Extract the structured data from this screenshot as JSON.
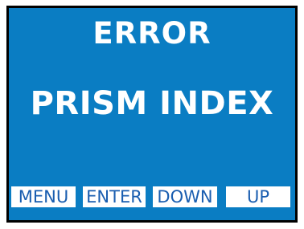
{
  "display": {
    "title": "ERROR",
    "message": "PRISM INDEX",
    "background_color": "#0a7dc3",
    "text_color": "#ffffff"
  },
  "softkeys": {
    "menu": "MENU",
    "enter": "ENTER",
    "down": "DOWN",
    "up": "UP",
    "label_color": "#1a5eb0",
    "key_background": "#ffffff"
  }
}
